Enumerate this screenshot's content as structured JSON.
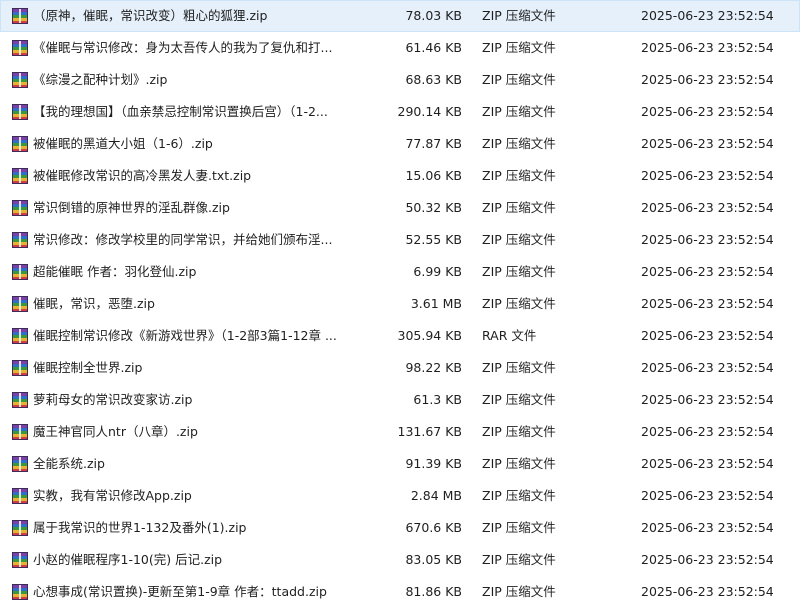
{
  "files": [
    {
      "name": "（原神，催眠，常识改变）粗心的狐狸.zip",
      "size": "78.03 KB",
      "type": "ZIP 压缩文件",
      "modified": "2025-06-23 23:52:54",
      "selected": true
    },
    {
      "name": "《催眠与常识修改：身为太吾传人的我为了复仇和打...",
      "size": "61.46 KB",
      "type": "ZIP 压缩文件",
      "modified": "2025-06-23 23:52:54"
    },
    {
      "name": "《综漫之配种计划》.zip",
      "size": "68.63 KB",
      "type": "ZIP 压缩文件",
      "modified": "2025-06-23 23:52:54"
    },
    {
      "name": "【我的理想国】（血亲禁忌控制常识置换后宫）（1-2...",
      "size": "290.14 KB",
      "type": "ZIP 压缩文件",
      "modified": "2025-06-23 23:52:54"
    },
    {
      "name": "被催眠的黑道大小姐（1-6）.zip",
      "size": "77.87 KB",
      "type": "ZIP 压缩文件",
      "modified": "2025-06-23 23:52:54"
    },
    {
      "name": "被催眠修改常识的高冷黑发人妻.txt.zip",
      "size": "15.06 KB",
      "type": "ZIP 压缩文件",
      "modified": "2025-06-23 23:52:54"
    },
    {
      "name": "常识倒错的原神世界的淫乱群像.zip",
      "size": "50.32 KB",
      "type": "ZIP 压缩文件",
      "modified": "2025-06-23 23:52:54"
    },
    {
      "name": "常识修改：修改学校里的同学常识，并给她们颁布淫...",
      "size": "52.55 KB",
      "type": "ZIP 压缩文件",
      "modified": "2025-06-23 23:52:54"
    },
    {
      "name": "超能催眠 作者：羽化登仙.zip",
      "size": "6.99 KB",
      "type": "ZIP 压缩文件",
      "modified": "2025-06-23 23:52:54"
    },
    {
      "name": "催眠，常识，恶堕.zip",
      "size": "3.61 MB",
      "type": "ZIP 压缩文件",
      "modified": "2025-06-23 23:52:54"
    },
    {
      "name": "催眠控制常识修改《新游戏世界》（1-2部3篇1-12章 ...",
      "size": "305.94 KB",
      "type": "RAR 文件",
      "modified": "2025-06-23 23:52:54"
    },
    {
      "name": "催眠控制全世界.zip",
      "size": "98.22 KB",
      "type": "ZIP 压缩文件",
      "modified": "2025-06-23 23:52:54"
    },
    {
      "name": "萝莉母女的常识改变家访.zip",
      "size": "61.3 KB",
      "type": "ZIP 压缩文件",
      "modified": "2025-06-23 23:52:54"
    },
    {
      "name": "魔王神官同人ntr（八章）.zip",
      "size": "131.67 KB",
      "type": "ZIP 压缩文件",
      "modified": "2025-06-23 23:52:54"
    },
    {
      "name": "全能系统.zip",
      "size": "91.39 KB",
      "type": "ZIP 压缩文件",
      "modified": "2025-06-23 23:52:54"
    },
    {
      "name": "实教，我有常识修改App.zip",
      "size": "2.84 MB",
      "type": "ZIP 压缩文件",
      "modified": "2025-06-23 23:52:54"
    },
    {
      "name": "属于我常识的世界1-132及番外(1).zip",
      "size": "670.6 KB",
      "type": "ZIP 压缩文件",
      "modified": "2025-06-23 23:52:54"
    },
    {
      "name": "小赵的催眠程序1-10(完) 后记.zip",
      "size": "83.05 KB",
      "type": "ZIP 压缩文件",
      "modified": "2025-06-23 23:52:54"
    },
    {
      "name": "心想事成(常识置换)-更新至第1-9章 作者：ttadd.zip",
      "size": "81.86 KB",
      "type": "ZIP 压缩文件",
      "modified": "2025-06-23 23:52:54"
    }
  ],
  "icons": {
    "archive": "archive-file-icon",
    "colors": [
      "#7b3fa8",
      "#2f6ec9",
      "#3a9a3a",
      "#e8b52a",
      "#d63d3d"
    ]
  }
}
